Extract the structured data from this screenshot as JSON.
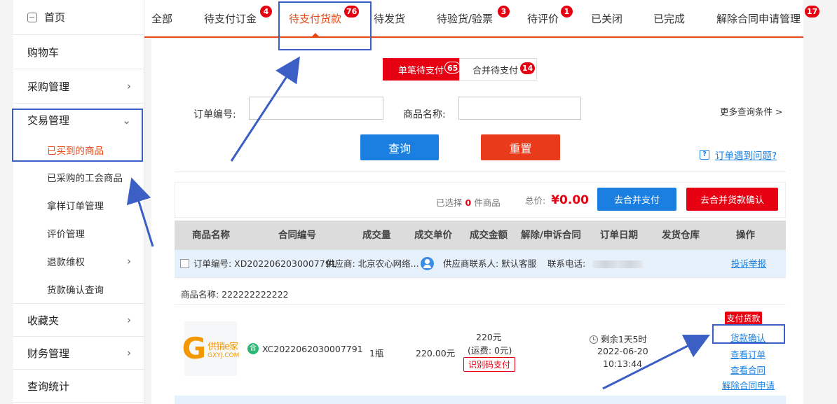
{
  "sidebar": {
    "home": "首页",
    "cart": "购物车",
    "purchase": "采购管理",
    "trade": "交易管理",
    "trade_sub": [
      "已买到的商品",
      "已采购的工会商品",
      "拿样订单管理",
      "评价管理",
      "退款维权",
      "货款确认查询"
    ],
    "favorites": "收藏夹",
    "finance": "财务管理",
    "stats": "查询统计"
  },
  "tabs": [
    {
      "label": "全部",
      "badge": ""
    },
    {
      "label": "待支付订金",
      "badge": "4"
    },
    {
      "label": "待支付货款",
      "badge": "76"
    },
    {
      "label": "待发货",
      "badge": ""
    },
    {
      "label": "待验货/验票",
      "badge": "3"
    },
    {
      "label": "待评价",
      "badge": "1"
    },
    {
      "label": "已关闭",
      "badge": ""
    },
    {
      "label": "已完成",
      "badge": ""
    },
    {
      "label": "解除合同申请管理",
      "badge": "17"
    }
  ],
  "subtabs": [
    {
      "label": "单笔待支付",
      "badge": "65"
    },
    {
      "label": "合并待支付",
      "badge": "14"
    }
  ],
  "search": {
    "order_no_label": "订单编号:",
    "order_no_value": "",
    "product_label": "商品名称:",
    "product_value": "",
    "more": "更多查询条件 >",
    "query": "查询",
    "reset": "重置",
    "help": "订单遇到问题?"
  },
  "summary": {
    "selected_prefix": "已选择",
    "selected_count": "0",
    "selected_suffix": "件商品",
    "total_label": "总价:",
    "total_amount": "¥0.00",
    "merge_pay": "去合并支付",
    "merge_confirm": "去合并货款确认"
  },
  "table": {
    "headers": [
      "商品名称",
      "合同编号",
      "成交量",
      "成交单价",
      "成交金额",
      "解除/申诉合同",
      "订单日期",
      "发货仓库",
      "操作"
    ]
  },
  "order": {
    "order_no": "订单编号: XD2022062030007791",
    "supplier": "供应商: 北京农心网络...",
    "contact": "供应商联系人: 默认客服",
    "phone_label": "联系电话:",
    "complaint": "投诉举报",
    "product_name": "商品名称: 222222222222",
    "logo_text_1": "供销e家",
    "logo_text_2": "GXYJ.COM",
    "contract_badge": "合",
    "contract_no": "XC2022062030007791",
    "quantity": "1瓶",
    "unit_price": "220.00元",
    "amount": "220元",
    "freight": "(运费: 0元)",
    "code_pay": "识别码支付",
    "remaining": "剩余1天5时",
    "date": "2022-06-20",
    "time": "10:13:44",
    "pay_badge": "支付货款",
    "actions": [
      "货款确认",
      "查看订单",
      "查看合同",
      "解除合同申请"
    ]
  },
  "colors": {
    "accent_red": "#e60012",
    "tab_orange": "#e64a19",
    "blue": "#1a7fe0",
    "annotation": "#3b5fc4"
  }
}
